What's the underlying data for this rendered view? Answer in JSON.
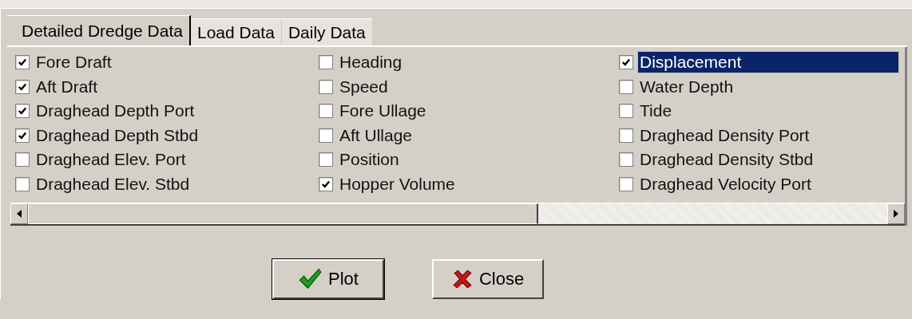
{
  "tabs": [
    {
      "label": "Detailed Dredge Data",
      "selected": true
    },
    {
      "label": "Load Data",
      "selected": false
    },
    {
      "label": "Daily Data",
      "selected": false
    }
  ],
  "items": [
    {
      "label": "Fore Draft",
      "checked": true,
      "selected": false
    },
    {
      "label": "Aft Draft",
      "checked": true,
      "selected": false
    },
    {
      "label": "Draghead Depth Port",
      "checked": true,
      "selected": false
    },
    {
      "label": "Draghead Depth Stbd",
      "checked": true,
      "selected": false
    },
    {
      "label": "Draghead Elev. Port",
      "checked": false,
      "selected": false
    },
    {
      "label": "Draghead Elev. Stbd",
      "checked": false,
      "selected": false
    },
    {
      "label": "Heading",
      "checked": false,
      "selected": false
    },
    {
      "label": "Speed",
      "checked": false,
      "selected": false
    },
    {
      "label": "Fore Ullage",
      "checked": false,
      "selected": false
    },
    {
      "label": "Aft Ullage",
      "checked": false,
      "selected": false
    },
    {
      "label": "Position",
      "checked": false,
      "selected": false
    },
    {
      "label": "Hopper Volume",
      "checked": true,
      "selected": false
    },
    {
      "label": "Displacement",
      "checked": true,
      "selected": true
    },
    {
      "label": "Water Depth",
      "checked": false,
      "selected": false
    },
    {
      "label": "Tide",
      "checked": false,
      "selected": false
    },
    {
      "label": "Draghead Density Port",
      "checked": false,
      "selected": false
    },
    {
      "label": "Draghead Density Stbd",
      "checked": false,
      "selected": false
    },
    {
      "label": "Draghead Velocity Port",
      "checked": false,
      "selected": false
    }
  ],
  "buttons": [
    {
      "label": "Plot",
      "kind": "ok"
    },
    {
      "label": "Close",
      "kind": "cancel"
    }
  ]
}
